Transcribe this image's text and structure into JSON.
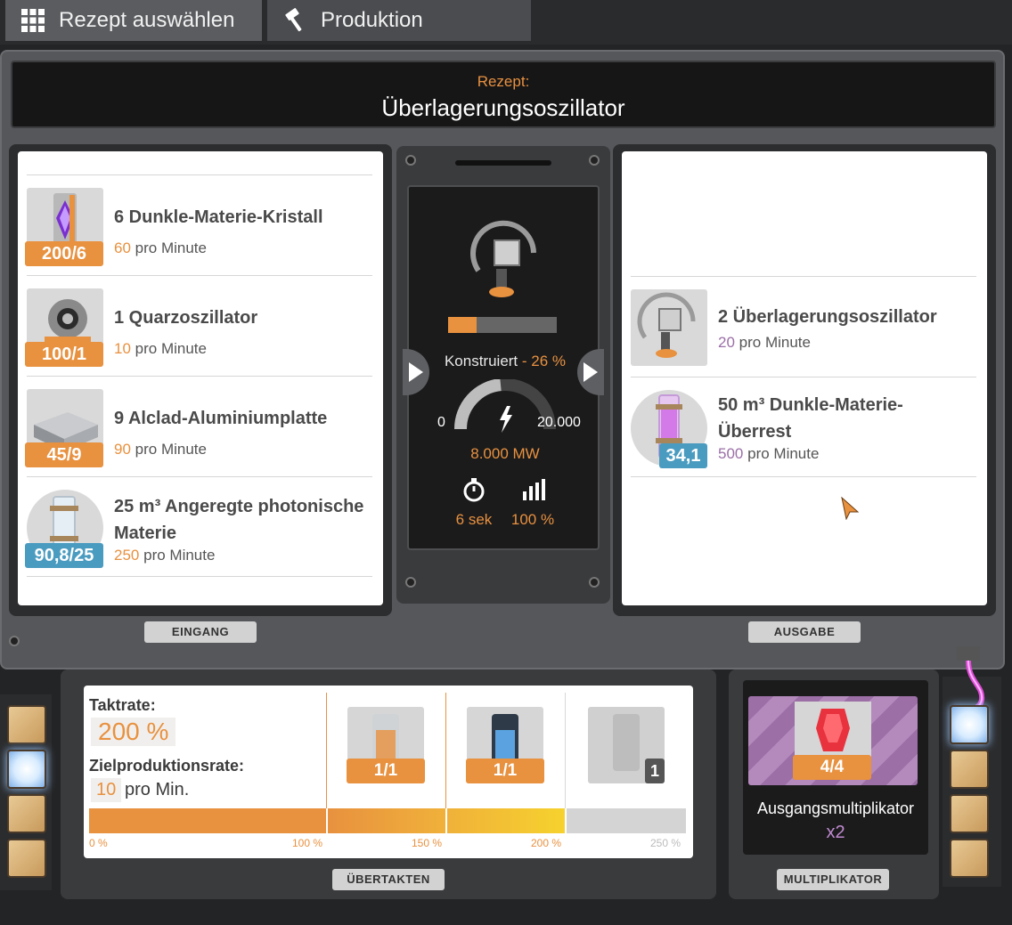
{
  "tabs": [
    {
      "label": "Rezept auswählen",
      "icon": "grid-icon"
    },
    {
      "label": "Produktion",
      "icon": "hammer-icon"
    }
  ],
  "recipe": {
    "label": "Rezept:",
    "name": "Überlagerungsoszillator"
  },
  "inputs": [
    {
      "name": "6 Dunkle-Materie-Kristall",
      "rate": "60",
      "unit": "pro Minute",
      "badge": "200/6",
      "badge_color": "#e8913f"
    },
    {
      "name": "1 Quarzoszillator",
      "rate": "10",
      "unit": "pro Minute",
      "badge": "100/1",
      "badge_color": "#e8913f"
    },
    {
      "name": "9 Alclad-Aluminiumplatte",
      "rate": "90",
      "unit": "pro Minute",
      "badge": "45/9",
      "badge_color": "#e8913f"
    },
    {
      "name": "25 m³ Angeregte photonische Materie",
      "rate": "250",
      "unit": "pro Minute",
      "badge": "90,8/25",
      "badge_color": "#4a9bc0"
    }
  ],
  "outputs": [
    {
      "name": "2 Überlagerungsoszillator",
      "rate": "20",
      "unit": "pro Minute"
    },
    {
      "name": "50 m³ Dunkle-Materie-Überrest",
      "rate": "500",
      "unit": "pro Minute",
      "badge": "34,1",
      "badge_color": "#4a9bc0"
    }
  ],
  "panel_tags": {
    "input": "EINGANG",
    "output": "AUSGABE",
    "overclock": "ÜBERTAKTEN",
    "multiplier": "MULTIPLIKATOR"
  },
  "machine": {
    "status_label": "Konstruiert",
    "status_pct": "- 26 %",
    "progress": 0.26,
    "gauge_min": "0",
    "gauge_max": "20.000",
    "power": "8.000 MW",
    "cycle_time": "6 sek",
    "efficiency": "100 %"
  },
  "overclock": {
    "clock_label": "Taktrate:",
    "clock_value": "200 %",
    "target_label": "Zielproduktionsrate:",
    "target_value": "10",
    "target_unit": "pro Min.",
    "shards": [
      {
        "badge": "1/1"
      },
      {
        "badge": "1/1"
      },
      {
        "badge": "1"
      }
    ],
    "ticks": [
      "0 %",
      "100 %",
      "150 %",
      "200 %",
      "250 %"
    ]
  },
  "multiplier": {
    "badge": "4/4",
    "title": "Ausgangsmultiplikator",
    "value": "x2"
  },
  "colors": {
    "accent": "#e8913f",
    "blue": "#4a9bc0",
    "purple": "#9b6fa8"
  }
}
